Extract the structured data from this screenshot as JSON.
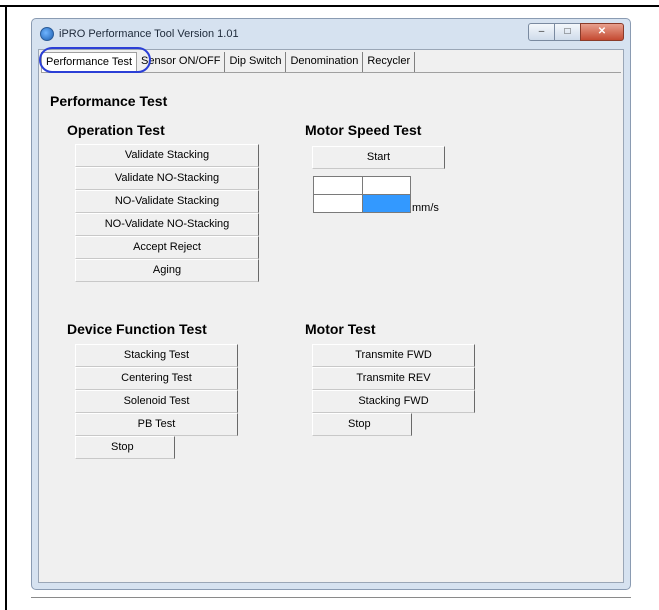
{
  "window": {
    "title": "iPRO Performance Tool Version  1.01",
    "controls": {
      "minimize": "–",
      "maximize": "□",
      "close": "✕"
    }
  },
  "tabs": [
    {
      "label": "Performance Test",
      "active": true
    },
    {
      "label": "Sensor ON/OFF"
    },
    {
      "label": "Dip Switch"
    },
    {
      "label": "Denomination"
    },
    {
      "label": "Recycler"
    }
  ],
  "page_title": "Performance Test",
  "operation_test": {
    "title": "Operation Test",
    "buttons": [
      "Validate Stacking",
      "Validate NO-Stacking",
      "NO-Validate Stacking",
      "NO-Validate NO-Stacking",
      "Accept Reject",
      "Aging"
    ]
  },
  "motor_speed_test": {
    "title": "Motor Speed Test",
    "start_label": "Start",
    "unit": "mm/s"
  },
  "device_function_test": {
    "title": "Device Function Test",
    "buttons": [
      "Stacking Test",
      "Centering Test",
      "Solenoid Test",
      "PB Test"
    ],
    "stop_label": "Stop"
  },
  "motor_test": {
    "title": "Motor Test",
    "buttons": [
      "Transmite FWD",
      "Transmite REV",
      "Stacking FWD"
    ],
    "stop_label": "Stop"
  },
  "colors": {
    "highlight": "#2b3fd6",
    "speed_cell": "#3399ff",
    "close_button": "#c44a31"
  }
}
